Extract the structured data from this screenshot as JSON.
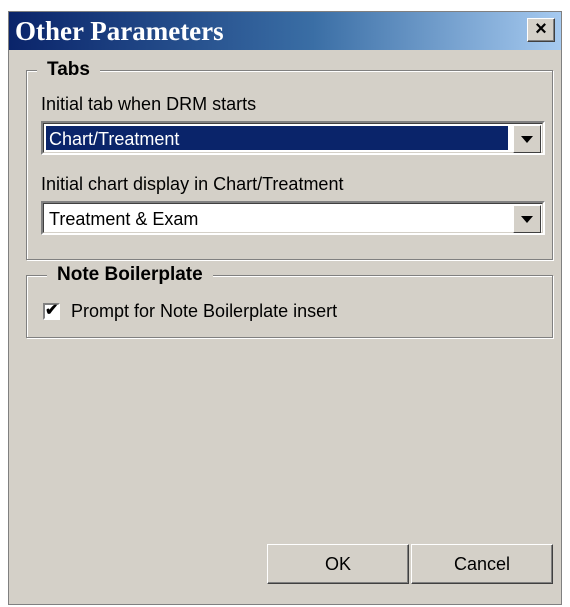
{
  "window": {
    "title": "Other Parameters",
    "close_label": "×"
  },
  "tabs_group": {
    "legend": "Tabs",
    "initial_tab_label": "Initial tab when DRM starts",
    "initial_tab_value": "Chart/Treatment",
    "initial_chart_label": "Initial chart display in Chart/Treatment",
    "initial_chart_value": "Treatment & Exam"
  },
  "boilerplate_group": {
    "legend": "Note Boilerplate",
    "prompt_label": "Prompt for Note Boilerplate insert",
    "prompt_checked": true,
    "check_mark": "✔"
  },
  "buttons": {
    "ok": "OK",
    "cancel": "Cancel"
  },
  "colors": {
    "title_start": "#0a246a",
    "title_end": "#a6caf0",
    "selection": "#0a246a",
    "face": "#d4d0c8"
  }
}
